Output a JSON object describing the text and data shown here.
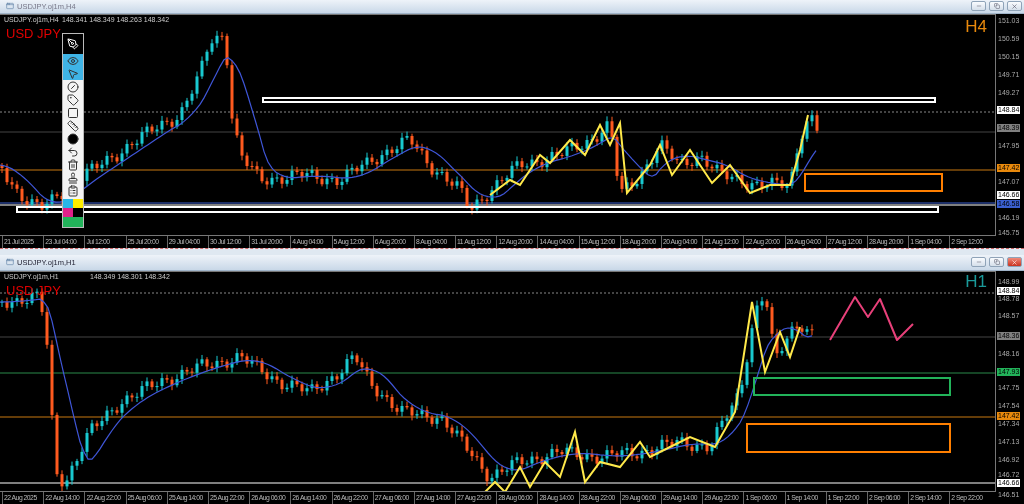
{
  "windows": [
    {
      "title": "USDJPY.oj1m,H4",
      "symbol_line": "USDJPY.oj1m,H4",
      "quote": "148.341 148.349 148.263 148.342",
      "symbol": "USD JPY",
      "timeframe": "H4",
      "color": "#e8890c",
      "active": false,
      "price_axis": [
        {
          "label": "151.03",
          "kind": "tick"
        },
        {
          "label": "150.59",
          "kind": "tick"
        },
        {
          "label": "150.15",
          "kind": "tick"
        },
        {
          "label": "149.71",
          "kind": "tick"
        },
        {
          "label": "149.27",
          "kind": "tick"
        },
        {
          "label": "148.84",
          "kind": "marker",
          "color": "#ffffff"
        },
        {
          "label": "148.39",
          "kind": "marker",
          "color": "#808080"
        },
        {
          "label": "147.95",
          "kind": "tick"
        },
        {
          "label": "147.42",
          "kind": "marker",
          "color": "#e8890c"
        },
        {
          "label": "147.07",
          "kind": "tick"
        },
        {
          "label": "146.66",
          "kind": "marker",
          "color": "#ffffff"
        },
        {
          "label": "146.58",
          "kind": "marker",
          "color": "#3a5fd0"
        },
        {
          "label": "146.19",
          "kind": "tick"
        },
        {
          "label": "145.75",
          "kind": "tick"
        }
      ],
      "time_axis": [
        "21 Jul 2025",
        "23 Jul 04:00",
        "Jul 12:00",
        "25 Jul 20:00",
        "29 Jul 04:00",
        "30 Jul 12:00",
        "31 Jul 20:00",
        "4 Aug 04:00",
        "5 Aug 12:00",
        "6 Aug 20:00",
        "8 Aug 04:00",
        "11 Aug 12:00",
        "12 Aug 20:00",
        "14 Aug 04:00",
        "15 Aug 12:00",
        "18 Aug 20:00",
        "20 Aug 04:00",
        "21 Aug 12:00",
        "22 Aug 20:00",
        "26 Aug 04:00",
        "27 Aug 12:00",
        "28 Aug 20:00",
        "1 Sep 04:00",
        "2 Sep 12:00"
      ]
    },
    {
      "title": "USDJPY.oj1m,H1",
      "symbol_line": "USDJPY.oj1m,H1",
      "quote": "148.349 148.301 148.342",
      "symbol": "USD JPY",
      "timeframe": "H1",
      "color": "#1a9a9a",
      "active": true,
      "price_axis": [
        {
          "label": "148.99",
          "kind": "tick"
        },
        {
          "label": "148.84",
          "kind": "marker",
          "color": "#ffffff"
        },
        {
          "label": "148.78",
          "kind": "tick"
        },
        {
          "label": "148.57",
          "kind": "tick"
        },
        {
          "label": "148.36",
          "kind": "marker",
          "color": "#808080"
        },
        {
          "label": "148.16",
          "kind": "tick"
        },
        {
          "label": "147.93",
          "kind": "marker",
          "color": "#22b35a"
        },
        {
          "label": "147.75",
          "kind": "tick"
        },
        {
          "label": "147.54",
          "kind": "tick"
        },
        {
          "label": "147.42",
          "kind": "marker",
          "color": "#e8890c"
        },
        {
          "label": "147.34",
          "kind": "tick"
        },
        {
          "label": "147.13",
          "kind": "tick"
        },
        {
          "label": "146.92",
          "kind": "tick"
        },
        {
          "label": "146.72",
          "kind": "tick"
        },
        {
          "label": "146.66",
          "kind": "marker",
          "color": "#ffffff"
        },
        {
          "label": "146.51",
          "kind": "tick"
        }
      ],
      "time_axis": [
        "22 Aug 2025",
        "22 Aug 14:00",
        "22 Aug 22:00",
        "25 Aug 06:00",
        "25 Aug 14:00",
        "25 Aug 22:00",
        "26 Aug 06:00",
        "26 Aug 14:00",
        "26 Aug 22:00",
        "27 Aug 06:00",
        "27 Aug 14:00",
        "27 Aug 22:00",
        "28 Aug 06:00",
        "28 Aug 14:00",
        "28 Aug 22:00",
        "29 Aug 06:00",
        "29 Aug 14:00",
        "29 Aug 22:00",
        "1 Sep 06:00",
        "1 Sep 14:00",
        "1 Sep 22:00",
        "2 Sep 06:00",
        "2 Sep 14:00",
        "2 Sep 22:00"
      ]
    }
  ],
  "toolbar": {
    "tools": [
      {
        "selected": false
      },
      {
        "selected": true
      },
      {
        "selected": true
      },
      {
        "selected": false
      },
      {
        "selected": false
      },
      {
        "selected": false
      },
      {
        "selected": false
      },
      {
        "selected": false
      },
      {
        "selected": false
      },
      {
        "selected": false
      },
      {
        "selected": false
      },
      {
        "selected": false
      }
    ],
    "swatches": [
      {
        "color": "#29b6e8"
      },
      {
        "color": "#ffee00"
      },
      {
        "color": "#e0208a"
      },
      {
        "color": "#000000"
      },
      {
        "color": "#22b35a"
      }
    ]
  }
}
